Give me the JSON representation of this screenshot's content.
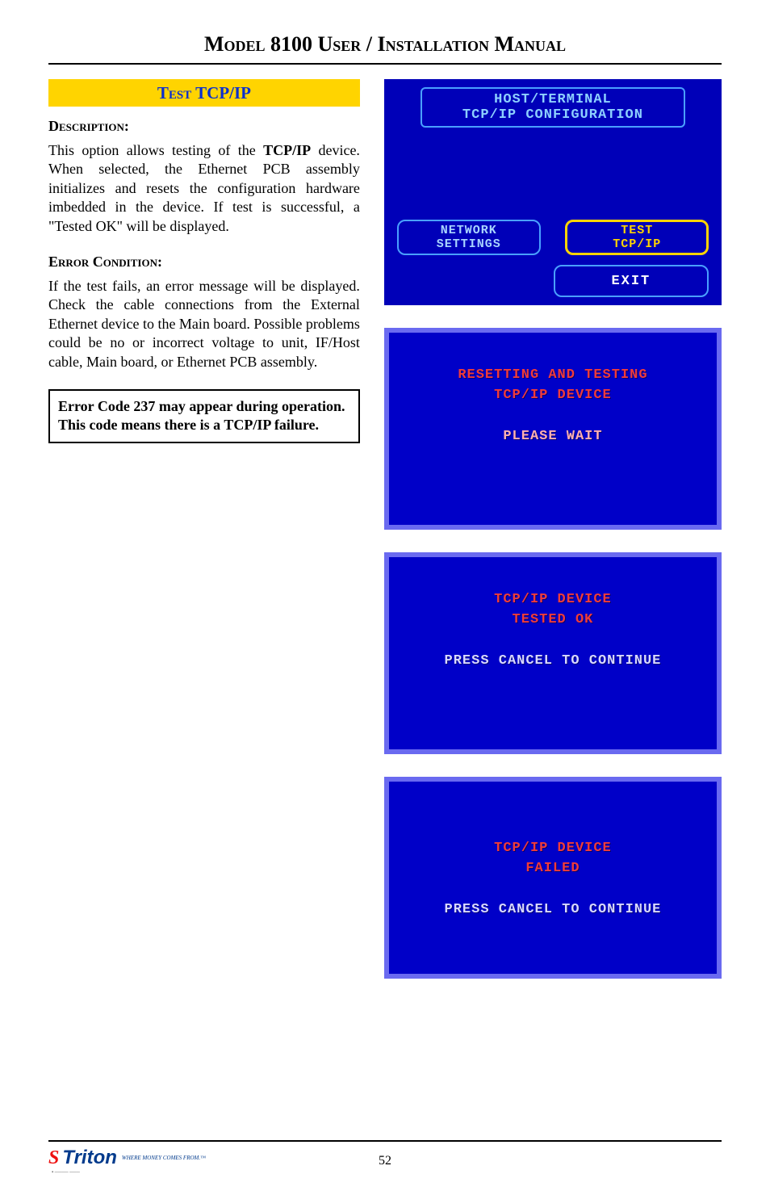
{
  "header_title": "Model 8100 User / Installation Manual",
  "strip_title": "Test TCP/IP",
  "section_desc_label": "Description:",
  "section_desc_text_prefix": "This option allows testing of the ",
  "section_desc_bold_term": "TCP/IP",
  "section_desc_text_rest": " device. When selected, the Ethernet PCB assembly initializes and resets the configuration hardware imbedded in the device.  If test is successful, a \"Tested OK\" will be displayed.",
  "section_err_label": "Error Condition:",
  "section_err_text": "If the test fails, an error message will be displayed.  Check the cable connections from the External Ethernet device to the Main board. Possible problems could be  no or incorrect voltage to unit, IF/Host cable, Main board, or Ethernet PCB assembly.",
  "note_text": "Error Code 237 may appear during operation.  This code means there is a TCP/IP failure.",
  "screen1": {
    "title_line1": "HOST/TERMINAL",
    "title_line2": "TCP/IP CONFIGURATION",
    "btn_network_l1": "NETWORK",
    "btn_network_l2": "SETTINGS",
    "btn_test_l1": "TEST",
    "btn_test_l2": "TCP/IP",
    "btn_exit": "EXIT"
  },
  "screen2": {
    "line1": "RESETTING AND TESTING",
    "line2": "TCP/IP DEVICE",
    "line3": "PLEASE WAIT"
  },
  "screen3": {
    "line1": "TCP/IP DEVICE",
    "line2": "TESTED OK",
    "line3": "PRESS CANCEL TO CONTINUE"
  },
  "screen4": {
    "line1": "TCP/IP DEVICE",
    "line2": "FAILED",
    "line3": "PRESS CANCEL TO CONTINUE"
  },
  "page_num": "52",
  "logo_text": "Triton",
  "logo_tag": "WHERE MONEY COMES FROM.™"
}
